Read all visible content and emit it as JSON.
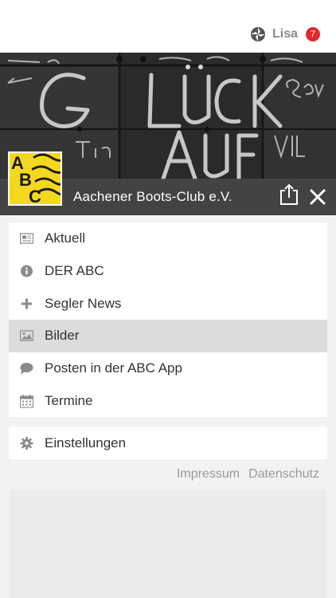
{
  "user": {
    "name": "Lisa",
    "badge_count": "7",
    "icon": "user-status-icon"
  },
  "header": {
    "club_name": "Aachener Boots-Club e.V.",
    "logo_letters": [
      "A",
      "B",
      "C"
    ],
    "share_icon": "share-icon",
    "close_icon": "close-icon"
  },
  "menu": {
    "items": [
      {
        "label": "Aktuell",
        "icon": "newspaper-icon",
        "active": false
      },
      {
        "label": "DER ABC",
        "icon": "info-icon",
        "active": false
      },
      {
        "label": "Segler News",
        "icon": "plus-icon",
        "active": false
      },
      {
        "label": "Bilder",
        "icon": "image-icon",
        "active": true
      },
      {
        "label": "Posten in der ABC App",
        "icon": "chat-bubble-icon",
        "active": false
      },
      {
        "label": "Termine",
        "icon": "calendar-icon",
        "active": false
      }
    ]
  },
  "settings": {
    "label": "Einstellungen",
    "icon": "gear-icon"
  },
  "footer": {
    "impressum": "Impressum",
    "datenschutz": "Datenschutz"
  },
  "colors": {
    "badge": "#e02a2a",
    "logo_yellow": "#f4d81d",
    "active_row": "#dcdcdc"
  }
}
